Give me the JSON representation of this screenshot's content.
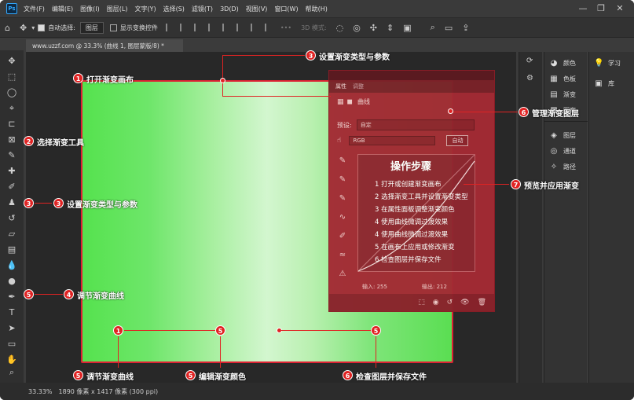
{
  "app": {
    "logo": "Ps"
  },
  "menu": [
    "文件(F)",
    "编辑(E)",
    "图像(I)",
    "图层(L)",
    "文字(Y)",
    "选择(S)",
    "滤镜(T)",
    "3D(D)",
    "视图(V)",
    "窗口(W)",
    "帮助(H)"
  ],
  "options": {
    "auto_select_label": "自动选择:",
    "auto_select_value": "图层",
    "show_transform_label": "显示变换控件",
    "mode_3d": "3D 模式:"
  },
  "document": {
    "tab_title": "www.uzzf.com @ 33.3% (曲线 1, 图层蒙版/8) *"
  },
  "status": {
    "zoom": "33.33%",
    "size": "1890 像素 x 1417 像素 (300 ppi)"
  },
  "right_panel": {
    "items": [
      "颜色",
      "色板",
      "渐变",
      "图案",
      "图层",
      "通道",
      "路径"
    ],
    "second": [
      "学习",
      "库"
    ]
  },
  "properties": {
    "tab_properties": "属性",
    "tab_info": "调整",
    "adjust_type": "曲线",
    "preset_label": "预设:",
    "preset_value": "自定",
    "channel_value": "RGB",
    "auto_button": "自动",
    "input_label": "输入: 255",
    "output_label": "输出: 212"
  },
  "steps": {
    "title": "操作步骤",
    "items": [
      "1 打开或创建渐变画布",
      "2 选择渐变工具并设置渐变类型",
      "3 在属性面板调整渐变颜色",
      "4 使用曲线微调过渡效果",
      "4 使用曲线微调过渡效果",
      "5 在画布上应用或修改渐变",
      "6 检查图层并保存文件"
    ]
  },
  "annotations": {
    "a1": {
      "num": "1",
      "text": "打开渐变画布"
    },
    "a2": {
      "num": "2",
      "text": "选择渐变工具"
    },
    "a3_left": {
      "num": "3",
      "text": "设置渐变类型与参数"
    },
    "a3_top": {
      "num": "3",
      "text": "设置渐变类型与参数"
    },
    "a4": {
      "num": "4",
      "text": "调节渐变曲线"
    },
    "a5_bottom_left": {
      "num": "5",
      "text": "调节渐变曲线"
    },
    "a5_bottom_mid": {
      "num": "5",
      "text": "编辑渐变颜色"
    },
    "a6_right": {
      "num": "6",
      "text": "管理渐变图层"
    },
    "a6_bottom": {
      "num": "6",
      "text": "检查图层并保存文件"
    },
    "a7": {
      "num": "7",
      "text": "预览并应用渐变"
    },
    "tool_badge_3": "3",
    "tool_badge_5": "5",
    "canvas_badge_1": "1",
    "canvas_badge_5a": "5",
    "canvas_badge_5b": "5"
  }
}
